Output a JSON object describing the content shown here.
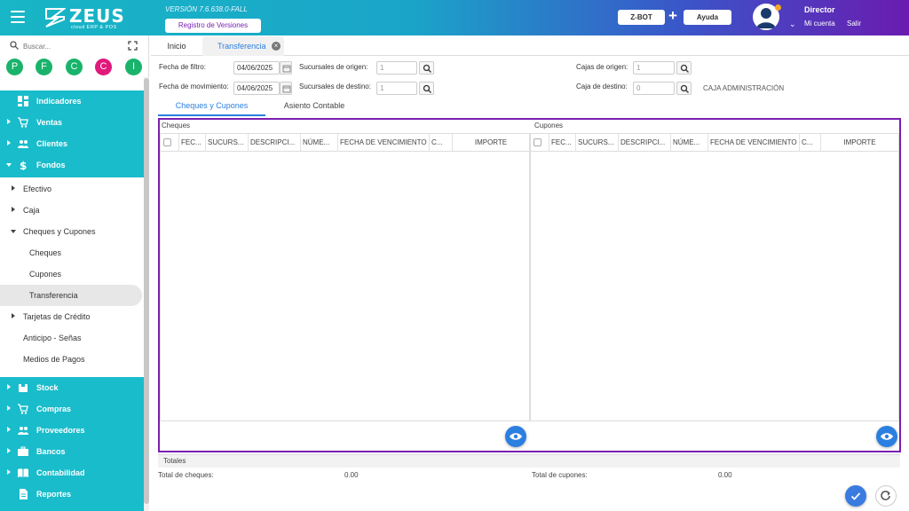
{
  "header": {
    "logo_text": "ZEUS",
    "logo_sub": "cloud ERP & POS",
    "version": "VERSIÓN 7.6.638.0-FALL",
    "registro_label": "Registro de Versiones",
    "zbot_label": "Z-BOT",
    "plus": "+",
    "ayuda_label": "Ayuda",
    "user_name": "Director",
    "mi_cuenta": "Mi cuenta",
    "salir": "Salir"
  },
  "sidebar": {
    "search_placeholder": "Buscar...",
    "letters": [
      {
        "letter": "P",
        "color": "#19b36b"
      },
      {
        "letter": "F",
        "color": "#19b36b"
      },
      {
        "letter": "C",
        "color": "#19b36b"
      },
      {
        "letter": "C",
        "color": "#e0197a"
      },
      {
        "letter": "I",
        "color": "#19b36b"
      }
    ],
    "indicadores": "Indicadores",
    "ventas": "Ventas",
    "clientes": "Clientes",
    "fondos": "Fondos",
    "efectivo": "Efectivo",
    "caja": "Caja",
    "cheques_y_cupones": "Cheques y Cupones",
    "cheques": "Cheques",
    "cupones": "Cupones",
    "transferencia": "Transferencia",
    "tarjetas": "Tarjetas de Crédito",
    "anticipo": "Anticipo - Señas",
    "medios": "Medios de Pagos",
    "stock": "Stock",
    "compras": "Compras",
    "proveedores": "Proveedores",
    "bancos": "Bancos",
    "contabilidad": "Contabilidad",
    "reportes": "Reportes"
  },
  "tabs": {
    "inicio": "Inicio",
    "transferencia": "Transferencia",
    "close": "×"
  },
  "form": {
    "fecha_filtro_label": "Fecha de filtro:",
    "fecha_filtro_value": "04/06/2025",
    "fecha_mov_label": "Fecha de movimiento:",
    "fecha_mov_value": "04/06/2025",
    "suc_origen_label": "Sucursales de origen:",
    "suc_origen_value": "1",
    "suc_destino_label": "Sucursales de destino:",
    "suc_destino_value": "1",
    "cajas_origen_label": "Cajas de origen:",
    "cajas_origen_value": "1",
    "caja_destino_label": "Caja de destino:",
    "caja_destino_value": "0",
    "caja_destino_name": "CAJA ADMINISTRACIÓN"
  },
  "subtabs": {
    "cheques_cupones": "Cheques y Cupones",
    "asiento": "Asiento Contable"
  },
  "cheques_panel": {
    "title": "Cheques",
    "columns": [
      "FEC...",
      "SUCURS...",
      "DESCRIPCI...",
      "NÚME...",
      "FECHA DE VENCIMIENTO",
      "C...",
      "IMPORTE"
    ]
  },
  "cupones_panel": {
    "title": "Cupones",
    "columns": [
      "FEC...",
      "SUCURS...",
      "DESCRIPCI...",
      "NÚME...",
      "FECHA DE VENCIMIENTO",
      "C...",
      "IMPORTE"
    ]
  },
  "totals": {
    "title": "Totales",
    "cheques_label": "Total de cheques:",
    "cheques_value": "0.00",
    "cupones_label": "Total de cupones:",
    "cupones_value": "0.00"
  },
  "colors": {
    "accent": "#2b7fe0",
    "sidebar": "#19bccb",
    "frame": "#7a1fb0"
  }
}
